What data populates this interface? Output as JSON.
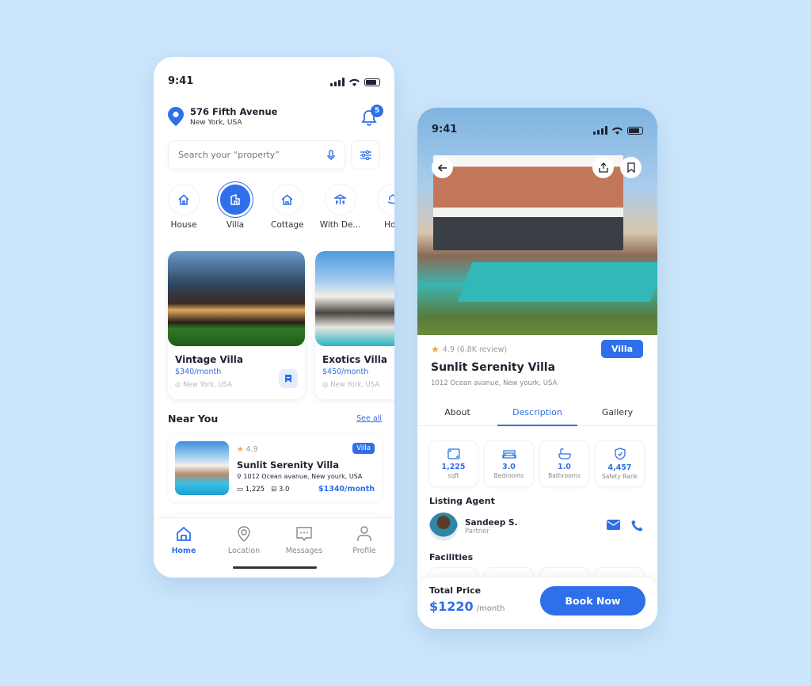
{
  "home": {
    "status": {
      "time": "9:41"
    },
    "location": {
      "title": "576 Fifth Avenue",
      "subtitle": "New York, USA"
    },
    "notifications": {
      "count": "5"
    },
    "search": {
      "placeholder": "Search your “property”"
    },
    "categories": [
      {
        "label": "House",
        "icon": "house-icon",
        "active": false
      },
      {
        "label": "Villa",
        "icon": "villa-icon",
        "active": true
      },
      {
        "label": "Cottage",
        "icon": "cottage-icon",
        "active": false
      },
      {
        "label": "With De...",
        "icon": "deck-icon",
        "active": false
      },
      {
        "label": "Hou",
        "icon": "houseboat-icon",
        "active": false
      }
    ],
    "featured": [
      {
        "name": "Vintage Villa",
        "price": "$340/month",
        "location": "New York, USA"
      },
      {
        "name": "Exotics Villa",
        "price": "$450/month",
        "location": "New York, USA"
      }
    ],
    "near_you": {
      "title": "Near You",
      "see_all": "See all",
      "items": [
        {
          "rating": "4.9",
          "tag": "Villa",
          "name": "Sunlit Serenity Villa",
          "address": "1012 Ocean avanue, New yourk, USA",
          "area": "1,225",
          "beds": "3.0",
          "price": "$1340/month"
        }
      ]
    },
    "tabbar": [
      {
        "label": "Home",
        "icon": "home-icon",
        "active": true
      },
      {
        "label": "Location",
        "icon": "location-pin-icon",
        "active": false
      },
      {
        "label": "Messages",
        "icon": "chat-icon",
        "active": false
      },
      {
        "label": "Profile",
        "icon": "profile-icon",
        "active": false
      }
    ]
  },
  "detail": {
    "status": {
      "time": "9:41"
    },
    "rating": "4.9 (6.8K review)",
    "tag": "Villa",
    "title": "Sunlit Serenity Villa",
    "address": "1012 Ocean avanue, New yourk, USA",
    "tabs": [
      {
        "label": "About",
        "active": false
      },
      {
        "label": "Description",
        "active": true
      },
      {
        "label": "Gallery",
        "active": false
      }
    ],
    "stats": [
      {
        "value": "1,225",
        "label": "sqft",
        "icon": "area-icon"
      },
      {
        "value": "3.0",
        "label": "Bedrooms",
        "icon": "bed-icon"
      },
      {
        "value": "1.0",
        "label": "Bathrooms",
        "icon": "bathtub-icon"
      },
      {
        "value": "4,457",
        "label": "Safety Rank",
        "icon": "shield-check-icon"
      }
    ],
    "agent_heading": "Listing Agent",
    "agent": {
      "name": "Sandeep S.",
      "role": "Partner"
    },
    "facilities_heading": "Facilities",
    "total_label": "Total Price",
    "total_value": "$1220",
    "total_unit": "/month",
    "book_label": "Book Now"
  },
  "colors": {
    "accent": "#2f6fe9",
    "background": "#cbe6fb",
    "star": "#f2a33a"
  }
}
